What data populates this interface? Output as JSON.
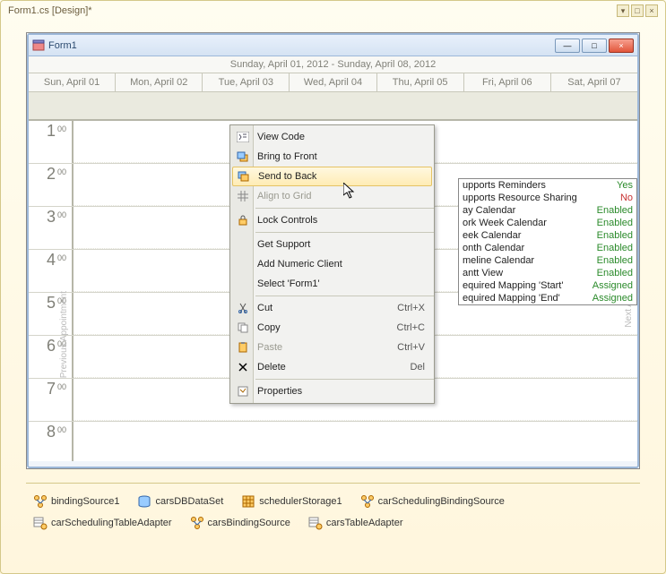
{
  "outer_title": "Form1.cs [Design]*",
  "form": {
    "title": "Form1"
  },
  "calendar": {
    "range": "Sunday, April 01, 2012 - Sunday, April 08, 2012",
    "days": [
      "Sun, April 01",
      "Mon, April 02",
      "Tue, April 03",
      "Wed, April 04",
      "Thu, April 05",
      "Fri, April 06",
      "Sat, April 07"
    ],
    "hours": [
      {
        "n": "1",
        "m": "00"
      },
      {
        "n": "2",
        "m": "00"
      },
      {
        "n": "3",
        "m": "00"
      },
      {
        "n": "4",
        "m": "00"
      },
      {
        "n": "5",
        "m": "00"
      },
      {
        "n": "6",
        "m": "00"
      },
      {
        "n": "7",
        "m": "00"
      },
      {
        "n": "8",
        "m": "00"
      }
    ],
    "prev_label": "Previous Appointment",
    "next_label": "Next App"
  },
  "context_menu": {
    "items": [
      {
        "label": "View Code",
        "icon": "code-icon"
      },
      {
        "label": "Bring to Front",
        "icon": "bring-front-icon"
      },
      {
        "label": "Send to Back",
        "icon": "send-back-icon",
        "hover": true
      },
      {
        "label": "Align to Grid",
        "icon": "grid-icon",
        "disabled": true
      },
      {
        "sep": true
      },
      {
        "label": "Lock Controls",
        "icon": "lock-icon"
      },
      {
        "sep": true
      },
      {
        "label": "Get Support"
      },
      {
        "label": "Add Numeric Client"
      },
      {
        "label": "Select 'Form1'"
      },
      {
        "sep": true
      },
      {
        "label": "Cut",
        "icon": "cut-icon",
        "shortcut": "Ctrl+X"
      },
      {
        "label": "Copy",
        "icon": "copy-icon",
        "shortcut": "Ctrl+C"
      },
      {
        "label": "Paste",
        "icon": "paste-icon",
        "shortcut": "Ctrl+V",
        "disabled": true
      },
      {
        "label": "Delete",
        "icon": "delete-icon",
        "shortcut": "Del"
      },
      {
        "sep": true
      },
      {
        "label": "Properties",
        "icon": "props-icon"
      }
    ]
  },
  "smart_panel": {
    "rows": [
      {
        "k": "upports Reminders",
        "v": "Yes",
        "cls": "green"
      },
      {
        "k": "upports Resource Sharing",
        "v": "No",
        "cls": "red"
      },
      {
        "k": "ay Calendar",
        "v": "Enabled",
        "cls": "green"
      },
      {
        "k": "ork Week Calendar",
        "v": "Enabled",
        "cls": "green"
      },
      {
        "k": "eek Calendar",
        "v": "Enabled",
        "cls": "green"
      },
      {
        "k": "onth Calendar",
        "v": "Enabled",
        "cls": "green"
      },
      {
        "k": "meline Calendar",
        "v": "Enabled",
        "cls": "green"
      },
      {
        "k": "antt View",
        "v": "Enabled",
        "cls": "green"
      },
      {
        "k": "equired Mapping 'Start'",
        "v": "Assigned",
        "cls": "green"
      },
      {
        "k": "equired Mapping 'End'",
        "v": "Assigned",
        "cls": "green"
      }
    ]
  },
  "components": [
    {
      "name": "bindingSource1",
      "icon": "bs"
    },
    {
      "name": "carsDBDataSet",
      "icon": "ds"
    },
    {
      "name": "schedulerStorage1",
      "icon": "ss"
    },
    {
      "name": "carSchedulingBindingSource",
      "icon": "bs"
    },
    {
      "name": "carSchedulingTableAdapter",
      "icon": "ta"
    },
    {
      "name": "carsBindingSource",
      "icon": "bs"
    },
    {
      "name": "carsTableAdapter",
      "icon": "ta"
    }
  ]
}
